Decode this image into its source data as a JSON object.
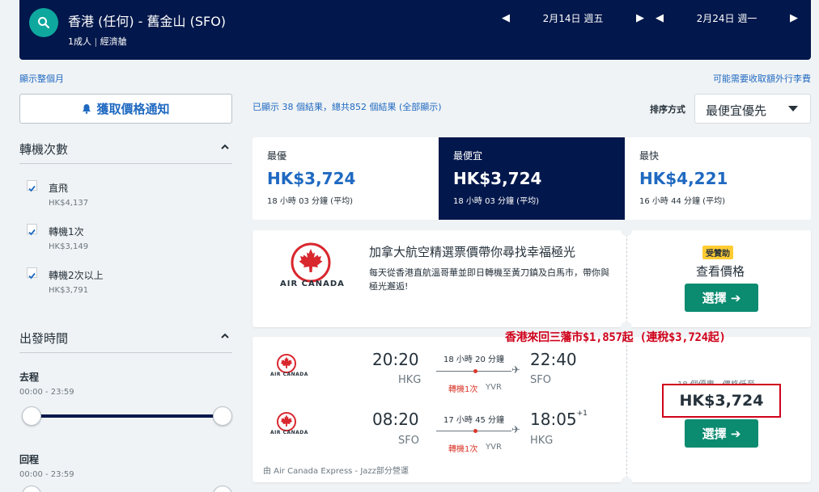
{
  "header": {
    "route": "香港 (任何) - 舊金山 (SFO)",
    "passengers": "1成人",
    "cabin": "經濟艙",
    "depart_date": "2月14日 週五",
    "return_date": "2月24日 週一"
  },
  "links": {
    "show_month": "顯示整個月",
    "baggage_fees": "可能需要收取額外行李費"
  },
  "sidebar": {
    "price_alert": "獲取價格通知",
    "stops_title": "轉機次數",
    "stops": [
      {
        "label": "直飛",
        "price": "HK$4,137",
        "checked": true
      },
      {
        "label": "轉機1次",
        "price": "HK$3,149",
        "checked": true
      },
      {
        "label": "轉機2次以上",
        "price": "HK$3,791",
        "checked": true
      }
    ],
    "times_title": "出發時間",
    "outbound_label": "去程",
    "outbound_range": "00:00 - 23:59",
    "return_label": "回程",
    "return_range": "00:00 - 23:59"
  },
  "results": {
    "summary": "已顯示 38 個結果，總共852 個結果 (全部顯示)",
    "sort_label": "排序方式",
    "sort_value": "最便宜優先"
  },
  "tabs": [
    {
      "label": "最優",
      "price": "HK$3,724",
      "duration": "18 小時 03 分鐘 (平均)",
      "active": false
    },
    {
      "label": "最便宜",
      "price": "HK$3,724",
      "duration": "18 小時 03 分鐘 (平均)",
      "active": true
    },
    {
      "label": "最快",
      "price": "HK$4,221",
      "duration": "16 小時 44 分鐘 (平均)",
      "active": false
    }
  ],
  "ad": {
    "airline": "AIR CANADA",
    "title": "加拿大航空精選票價帶你尋找幸福極光",
    "description": "每天從香港直航溫哥華並即日轉機至黃刀鎮及白馬市，帶你與極光邂逅!",
    "sponsored": "受贊助",
    "view_price": "查看價格",
    "select": "選擇 ➔"
  },
  "flight": {
    "airline": "AIR CANADA",
    "outbound": {
      "depart_time": "20:20",
      "depart_airport": "HKG",
      "duration": "18 小時 20 分鐘",
      "stops": "轉機1次",
      "via": "YVR",
      "arrive_time": "22:40",
      "arrive_airport": "SFO",
      "day_offset": ""
    },
    "inbound": {
      "depart_time": "08:20",
      "depart_airport": "SFO",
      "duration": "17 小時 45 分鐘",
      "stops": "轉機1次",
      "via": "YVR",
      "arrive_time": "18:05",
      "arrive_airport": "HKG",
      "day_offset": "+1"
    },
    "operated_by": "由 Air Canada Express - Jazz部分營運",
    "deals": "18 個優惠，價格低至",
    "price": "HK$3,724",
    "select": "選擇 ➔"
  },
  "annotation": "香港來回三藩市$1,857起 (連稅$3,724起)",
  "colors": {
    "navy": "#02174b",
    "teal": "#0fa89e",
    "link_blue": "#1f69c1",
    "green_button": "#0b8b70",
    "air_canada_red": "#d9272e",
    "highlight_red": "#d0021b"
  }
}
